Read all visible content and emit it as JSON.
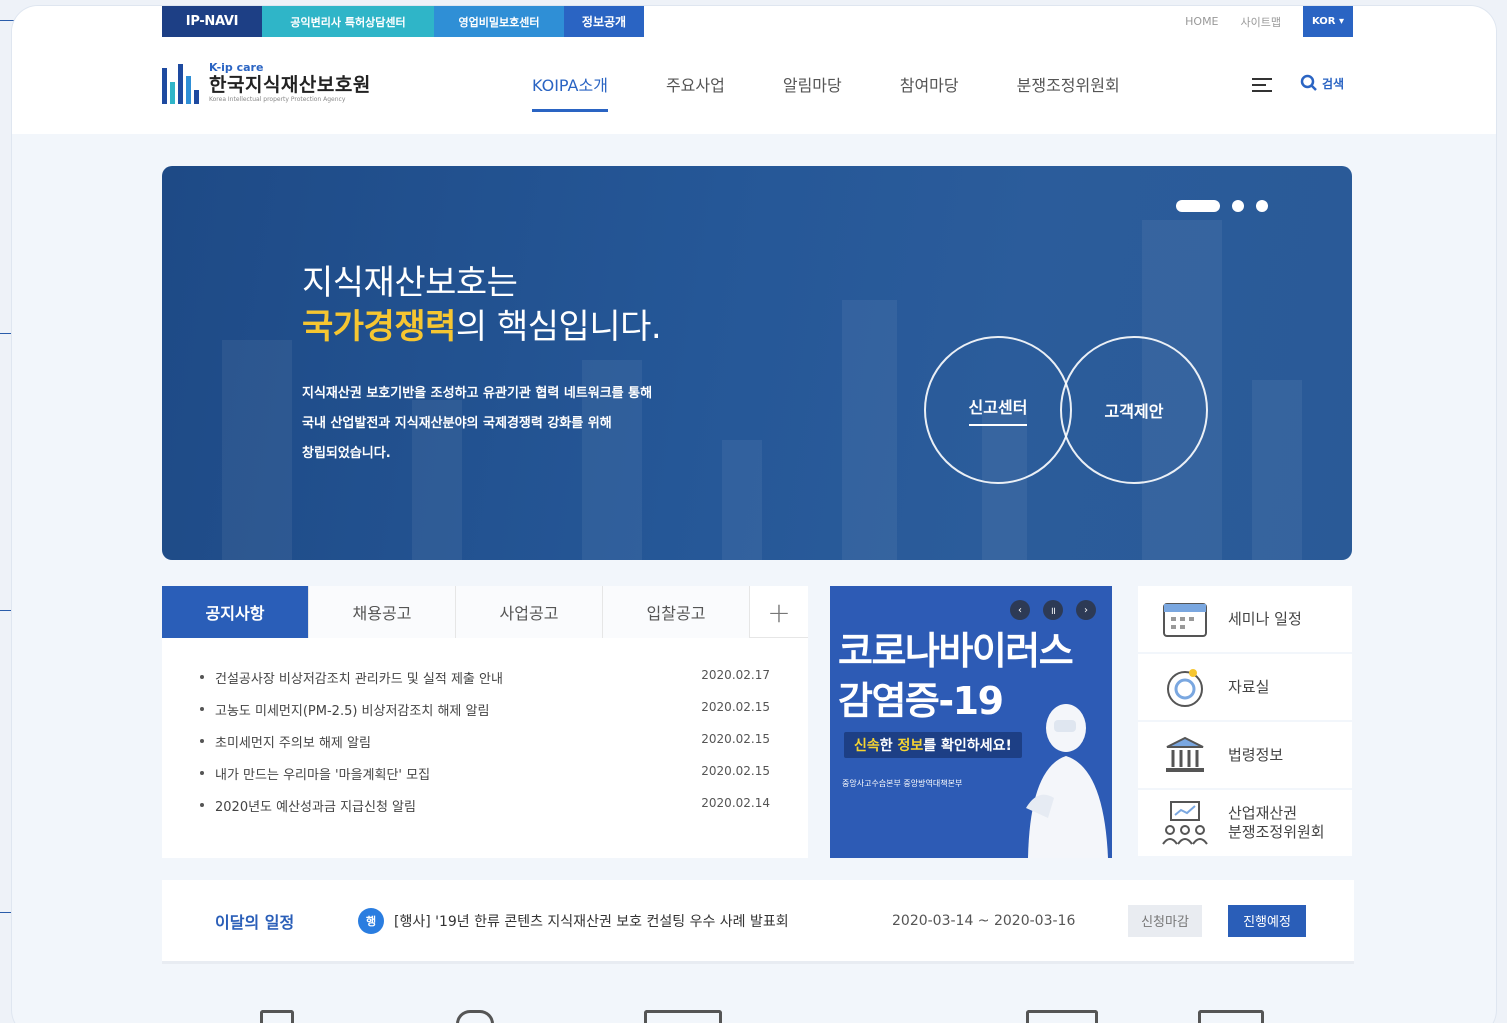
{
  "utility": {
    "tabs": [
      "IP-NAVI",
      "공익변리사 특허상담센터",
      "영업비밀보호센터",
      "정보공개"
    ],
    "home": "HOME",
    "sitemap": "사이트맵",
    "lang": "KOR ▾"
  },
  "logo": {
    "sub": "K-ip care",
    "name": "한국지식재산보호원",
    "en": "Korea Intellectual property Protection Agency"
  },
  "gnb": [
    "KOIPA소개",
    "주요사업",
    "알림마당",
    "참여마당",
    "분쟁조정위원회"
  ],
  "search_label": "검색",
  "hero": {
    "line1": "지식재산보호는",
    "highlight": "국가경쟁력",
    "line2_rest": "의 핵심입니다.",
    "desc1": "지식재산권 보호기반을 조성하고 유관기관 협력 네트워크를 통해",
    "desc2": "국내 산업발전과 지식재산분야의 국제경쟁력 강화를 위해",
    "desc3": "창립되었습니다.",
    "btn_report": "신고센터",
    "btn_proposal": "고객제안"
  },
  "board": {
    "tabs": [
      "공지사항",
      "채용공고",
      "사업공고",
      "입찰공고"
    ],
    "more": "+",
    "notices": [
      {
        "title": "건설공사장 비상저감조치 관리카드 및 실적 제출 안내",
        "date": "2020.02.17"
      },
      {
        "title": "고농도 미세먼지(PM-2.5) 비상저감조치 해제 알림",
        "date": "2020.02.15"
      },
      {
        "title": "초미세먼지 주의보 해제 알림",
        "date": "2020.02.15"
      },
      {
        "title": "내가 만드는 우리마을 '마을계획단' 모집",
        "date": "2020.02.15"
      },
      {
        "title": "2020년도 예산성과금 지급신청 알림",
        "date": "2020.02.14"
      }
    ]
  },
  "promo": {
    "title1": "코로나바이러스",
    "title2": "감염증-19",
    "sub_em1": "신속",
    "sub_mid": "한 ",
    "sub_em2": "정보",
    "sub_end": "를 확인하세요!",
    "orgs": "중앙사고수습본부   중앙방역대책본부",
    "prev": "‹",
    "pause": "॥",
    "next": "›"
  },
  "quick": [
    {
      "label": "세미나 일정",
      "icon": "calendar-icon"
    },
    {
      "label": "자료실",
      "icon": "archive-icon"
    },
    {
      "label": "법령정보",
      "icon": "law-building-icon"
    },
    {
      "label1": "산업재산권",
      "label2": "분쟁조정위원회",
      "icon": "committee-icon"
    }
  ],
  "schedule": {
    "title": "이달의 일정",
    "badge": "행",
    "event": "[행사] '19년 한류 콘텐츠 지식재산권 보호 컨설팅 우수 사례 발표회",
    "date": "2020-03-14 ~ 2020-03-16",
    "status1": "신청마감",
    "status2": "진행예정"
  },
  "colors": {
    "primary": "#2a5eb8",
    "navy": "#1d3f85",
    "highlight": "#f6c631"
  }
}
